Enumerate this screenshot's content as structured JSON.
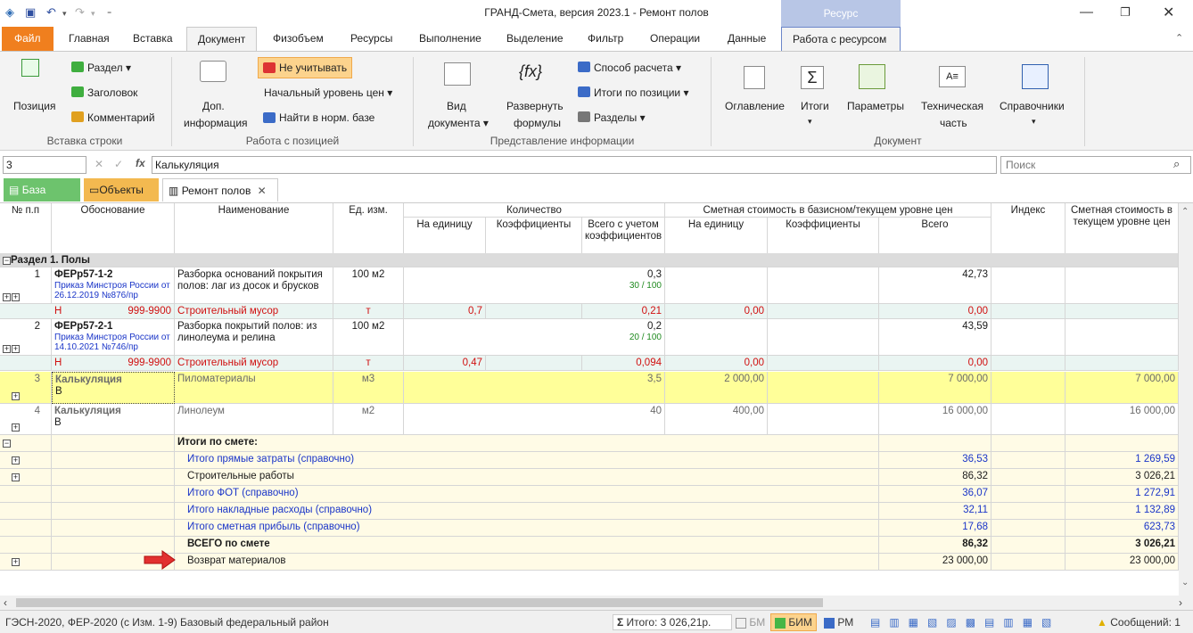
{
  "window": {
    "title": "ГРАНД-Смета, версия 2023.1 - Ремонт полов",
    "context_group": "Ресурс"
  },
  "tabs": [
    "Файл",
    "Главная",
    "Вставка",
    "Документ",
    "Физобъем",
    "Ресурсы",
    "Выполнение",
    "Выделение",
    "Фильтр",
    "Операции",
    "Данные",
    "Работа с ресурсом"
  ],
  "ribbon": {
    "pozitsiya": "Позиция",
    "razdel": "Раздел",
    "zagolovok": "Заголовок",
    "kommentariy": "Комментарий",
    "grp_vstavka": "Вставка строки",
    "dop1": "Доп.",
    "dop2": "информация",
    "ne_uchityvat": "Не учитывать",
    "nach_uroven": "Начальный уровень цен",
    "nayti": "Найти в норм. базе",
    "grp_rabota": "Работа с позицией",
    "vid1": "Вид",
    "vid2": "документа",
    "razv1": "Развернуть",
    "razv2": "формулы",
    "sposob": "Способ расчета",
    "itogi_poz": "Итоги по позиции",
    "razdely": "Разделы",
    "grp_predst": "Представление информации",
    "oglavlenie": "Оглавление",
    "itogi": "Итоги",
    "parametry": "Параметры",
    "tech1": "Техническая",
    "tech2": "часть",
    "spravochniki": "Справочники",
    "grp_dokument": "Документ"
  },
  "formula_bar": {
    "cell": "3",
    "value": "Калькуляция",
    "search_placeholder": "Поиск"
  },
  "doc_tabs": {
    "baza": "База",
    "obekty": "Объекты",
    "current": "Ремонт полов"
  },
  "headers": {
    "num": "№ п.п",
    "obosn": "Обоснование",
    "naim": "Наименование",
    "ed": "Ед. изм.",
    "kol": "Количество",
    "kol_ed": "На единицу",
    "kol_k": "Коэффициенты",
    "kol_vs": "Всего с учетом коэффициентов",
    "st": "Сметная стоимость в базисном/текущем уровне цен",
    "st_ed": "На единицу",
    "st_k": "Коэффициенты",
    "st_vs": "Всего",
    "index": "Индекс",
    "tek": "Сметная стоимость в текущем уровне цен"
  },
  "section": "Раздел 1. Полы",
  "rows": {
    "r1": {
      "num": "1",
      "code": "ФЕРр57-1-2",
      "doc": "Приказ Минстроя России от 26.12.2019 №876/пр",
      "name": "Разборка оснований покрытия полов: лаг из досок и брусков",
      "ed": "100 м2",
      "kol": "0,3",
      "frac": "30 / 100",
      "total": "42,73"
    },
    "r1s": {
      "tag": "Н",
      "code": "999-9900",
      "name": "Строительный мусор",
      "ed": "т",
      "ned": "0,7",
      "vs": "0,21",
      "sted": "0,00",
      "stvs": "0,00"
    },
    "r2": {
      "num": "2",
      "code": "ФЕРр57-2-1",
      "doc": "Приказ Минстроя России от 14.10.2021 №746/пр",
      "name": "Разборка покрытий полов: из линолеума и релина",
      "ed": "100 м2",
      "kol": "0,2",
      "frac": "20 / 100",
      "total": "43,59"
    },
    "r2s": {
      "tag": "Н",
      "code": "999-9900",
      "name": "Строительный мусор",
      "ed": "т",
      "ned": "0,47",
      "vs": "0,094",
      "sted": "0,00",
      "stvs": "0,00"
    },
    "r3": {
      "num": "3",
      "code": "Калькуляция",
      "sub": "В",
      "name": "Пиломатериалы",
      "ed": "м3",
      "kol": "3,5",
      "sted": "2 000,00",
      "stvs": "7 000,00",
      "tek": "7 000,00"
    },
    "r4": {
      "num": "4",
      "code": "Калькуляция",
      "sub": "В",
      "name": "Линолеум",
      "ed": "м2",
      "kol": "40",
      "sted": "400,00",
      "stvs": "16 000,00",
      "tek": "16 000,00"
    }
  },
  "totals": [
    {
      "label": "Итоги по смете:",
      "vs": "",
      "tek": ""
    },
    {
      "label": "Итого прямые затраты (справочно)",
      "vs": "36,53",
      "tek": "1 269,59"
    },
    {
      "label": "Строительные работы",
      "vs": "86,32",
      "tek": "3 026,21"
    },
    {
      "label": "Итого ФОТ (справочно)",
      "vs": "36,07",
      "tek": "1 272,91"
    },
    {
      "label": "Итого накладные расходы (справочно)",
      "vs": "32,11",
      "tek": "1 132,89"
    },
    {
      "label": "Итого сметная прибыль (справочно)",
      "vs": "17,68",
      "tek": "623,73"
    },
    {
      "label": "ВСЕГО по смете",
      "vs": "86,32",
      "tek": "3 026,21"
    },
    {
      "label": "Возврат материалов",
      "vs": "23 000,00",
      "tek": "23 000,00"
    }
  ],
  "status": {
    "base": "ГЭСН-2020, ФЕР-2020 (с Изм. 1-9)  Базовый федеральный район",
    "itog": "Итого: 3 026,21р.",
    "bm": "БМ",
    "bim": "БИМ",
    "rm": "РМ",
    "msg": "Сообщений: 1"
  },
  "colors": {
    "accent_orange": "#f07f1e",
    "context_blue": "#b8c6e6",
    "highlight_row": "#ffff99",
    "link_blue": "#1a35c8",
    "red": "#d01010",
    "green": "#1f8a1f"
  }
}
